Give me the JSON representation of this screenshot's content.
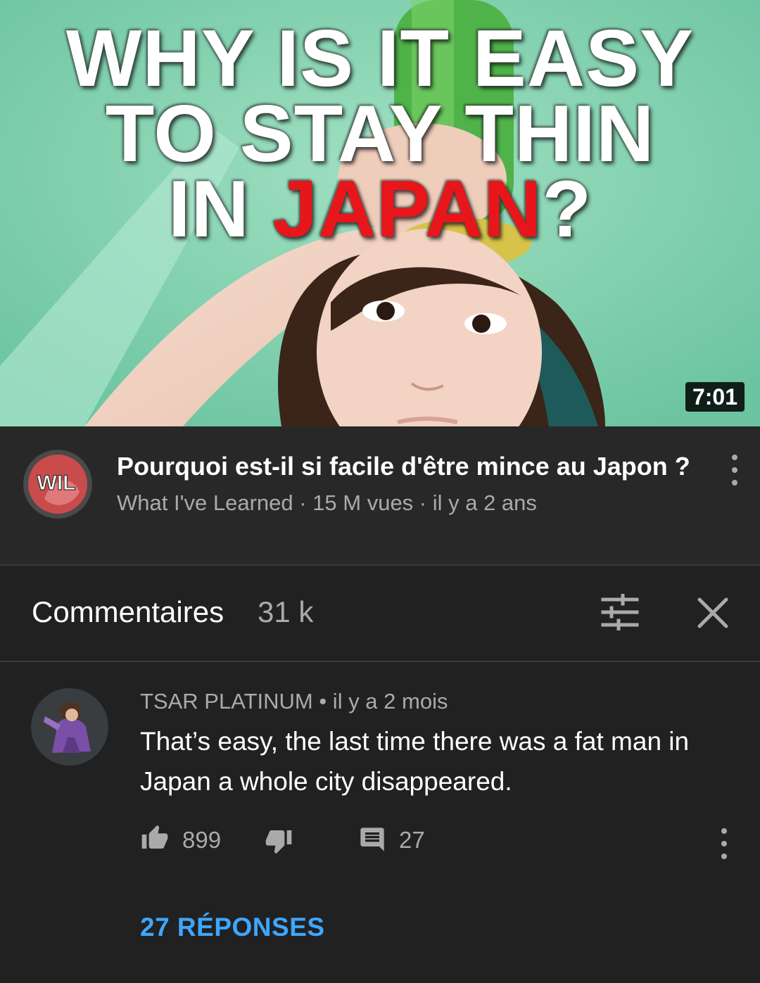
{
  "thumbnail": {
    "line1": "WHY IS IT EASY",
    "line2": "TO STAY THIN",
    "line3_prefix": "IN ",
    "line3_highlight": "JAPAN",
    "line3_suffix": "?",
    "duration": "7:01",
    "highlight_color": "#e8161b"
  },
  "video": {
    "title": "Pourquoi est-il si facile d'être mince au Japon ?",
    "meta": "What I've Learned · 15 M vues · il y a 2 ans",
    "channel_logo_text": "WIL",
    "more_icon": "more-vert-icon"
  },
  "comments_header": {
    "title": "Commentaires",
    "count": "31 k",
    "sort_icon": "sort-icon",
    "close_icon": "close-icon"
  },
  "comment": {
    "author_line": "TSAR PLATINUM • il y a 2 mois",
    "text": "That’s easy, the last time there was a fat man in Japan a whole city disappeared.",
    "likes": "899",
    "reply_count": "27",
    "replies_label": "27 RÉPONSES",
    "replies_color": "#3ea6ff"
  }
}
